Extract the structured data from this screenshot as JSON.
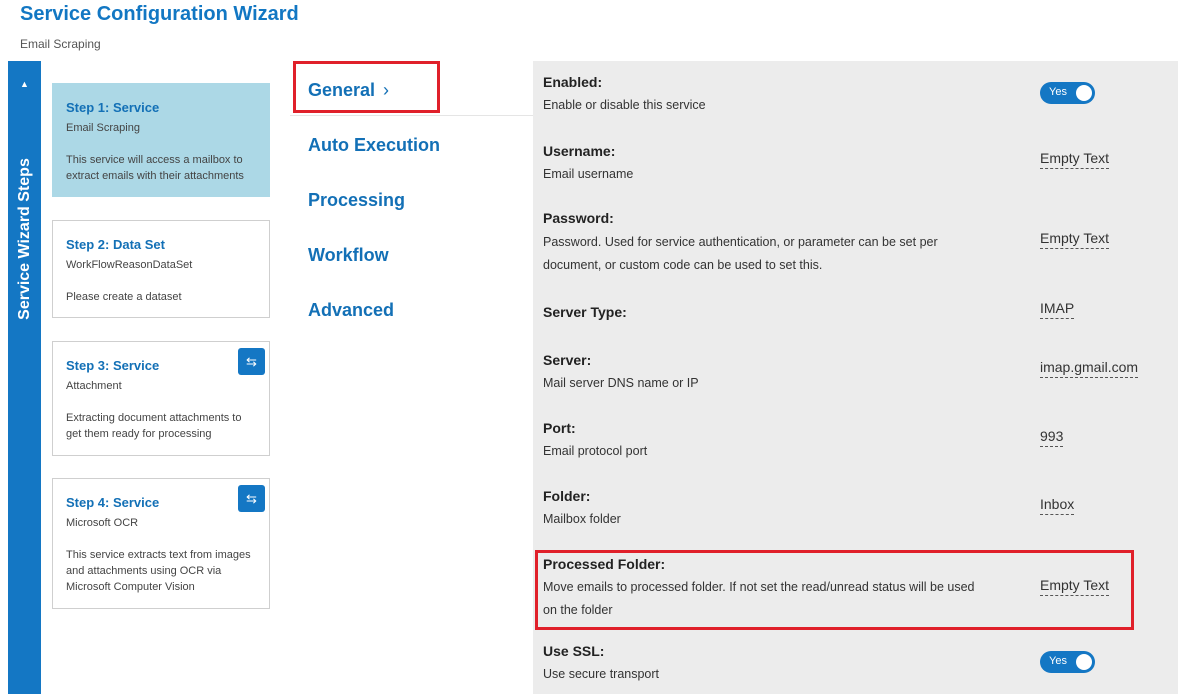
{
  "header": {
    "title": "Service Configuration Wizard",
    "subtitle": "Email Scraping"
  },
  "rail": {
    "label": "Service Wizard Steps",
    "collapse_glyph": "▲"
  },
  "steps": [
    {
      "title": "Step 1: Service",
      "subtitle": "Email Scraping",
      "description": "This service will access a mailbox to extract emails with their attachments"
    },
    {
      "title": "Step 2: Data Set",
      "subtitle": "WorkFlowReasonDataSet",
      "description": "Please create a dataset"
    },
    {
      "title": "Step 3: Service",
      "subtitle": "Attachment",
      "description": "Extracting document attachments to get them ready for processing",
      "button_icon": "swap-icon"
    },
    {
      "title": "Step 4: Service",
      "subtitle": "Microsoft OCR",
      "description": "This service extracts text from images and attachments using OCR via Microsoft Computer Vision",
      "button_icon": "swap-icon"
    }
  ],
  "nav": {
    "items": [
      "General",
      "Auto Execution",
      "Processing",
      "Workflow",
      "Advanced"
    ],
    "active": "General",
    "chevron": "›"
  },
  "settings": [
    {
      "label": "Enabled:",
      "description": "Enable or disable this service",
      "toggle": "Yes"
    },
    {
      "label": "Username:",
      "description": "Email username",
      "value": "Empty Text"
    },
    {
      "label": "Password:",
      "description": "Password. Used for service authentication, or parameter can be set per document, or custom code can be used to set this.",
      "value": "Empty Text"
    },
    {
      "label": "Server Type:",
      "description": "",
      "value": "IMAP"
    },
    {
      "label": "Server:",
      "description": "Mail server DNS name or IP",
      "value": "imap.gmail.com"
    },
    {
      "label": "Port:",
      "description": "Email protocol port",
      "value": "993"
    },
    {
      "label": "Folder:",
      "description": "Mailbox folder",
      "value": "Inbox"
    },
    {
      "label": "Processed Folder:",
      "description": "Move emails to processed folder. If not set the read/unread status will be used on the folder",
      "value": "Empty Text"
    },
    {
      "label": "Use SSL:",
      "description": "Use secure transport",
      "toggle": "Yes"
    }
  ],
  "colors": {
    "accent": "#1477c4",
    "active_step_bg": "#acd8e6",
    "highlight": "#e0202a",
    "panel_bg": "#ececec"
  }
}
